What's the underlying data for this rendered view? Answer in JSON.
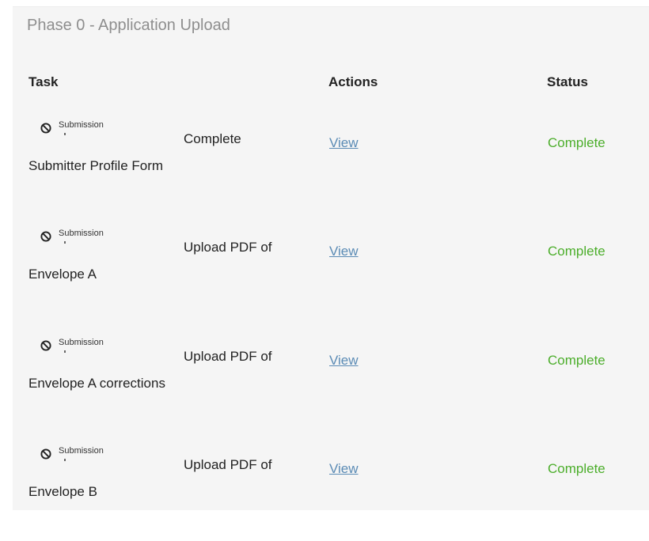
{
  "phase": {
    "title": "Phase 0 - Application Upload"
  },
  "table": {
    "headers": {
      "task": "Task",
      "actions": "Actions",
      "status": "Status"
    },
    "rows": [
      {
        "icon": "ban-icon",
        "submission_label": "Submission",
        "task_line1": "Complete",
        "task_line2": "Submitter Profile Form",
        "action": "View",
        "status": "Complete"
      },
      {
        "icon": "ban-icon",
        "submission_label": "Submission",
        "task_line1": "Upload PDF of",
        "task_line2": "Envelope A",
        "action": "View",
        "status": "Complete"
      },
      {
        "icon": "ban-icon",
        "submission_label": "Submission",
        "task_line1": "Upload PDF of",
        "task_line2": "Envelope A corrections",
        "action": "View",
        "status": "Complete"
      },
      {
        "icon": "ban-icon",
        "submission_label": "Submission",
        "task_line1": "Upload PDF of",
        "task_line2": "Envelope B",
        "action": "View",
        "status": "Complete"
      }
    ]
  },
  "colors": {
    "link": "#5b8bb5",
    "status_complete": "#4cae2b",
    "panel_background": "#f5f5f5",
    "phase_title": "#8e8e8e"
  }
}
